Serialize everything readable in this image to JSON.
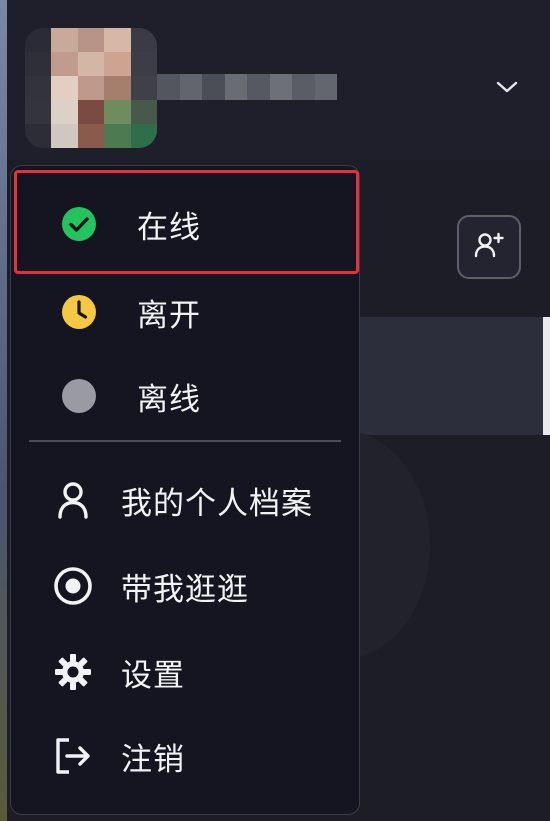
{
  "header": {
    "avatar_colors": [
      [
        "#2a2b36",
        "#c9a99a",
        "#b89488",
        "#d7b8a7",
        "#3a3b44"
      ],
      [
        "#2e2f38",
        "#c19c8e",
        "#d4b6a6",
        "#cda492",
        "#3c3d46"
      ],
      [
        "#33333d",
        "#e2cfc2",
        "#bf9a8c",
        "#a67e6c",
        "#3f4048"
      ],
      [
        "#34343e",
        "#ddd0c6",
        "#7a4b40",
        "#6e8c5e",
        "#47594a"
      ],
      [
        "#2c2d37",
        "#cfc7c0",
        "#8a5a4c",
        "#4e7a52",
        "#2f6e4a"
      ]
    ],
    "name_blur_colors": [
      "#54565f",
      "#63656e",
      "#4c4e57",
      "#6a6c74",
      "#575962",
      "#6e7078",
      "#5b5d66",
      "#64666f"
    ],
    "chevron_icon": "chevron-down-icon"
  },
  "menu": {
    "status_items": [
      {
        "label": "在线",
        "icon": "online-check-icon",
        "color": "#23c35d"
      },
      {
        "label": "离开",
        "icon": "away-clock-icon",
        "color": "#f5c842"
      },
      {
        "label": "离线",
        "icon": "offline-dot-icon",
        "color": "#9a9aa2"
      }
    ],
    "action_items": [
      {
        "label": "我的个人档案",
        "icon": "profile-icon"
      },
      {
        "label": "带我逛逛",
        "icon": "tour-target-icon"
      },
      {
        "label": "设置",
        "icon": "gear-icon"
      },
      {
        "label": "注销",
        "icon": "logout-icon"
      }
    ],
    "selected_status": "在线",
    "highlight_color": "#e8303a"
  },
  "toolbar": {
    "add_friend_icon": "add-friend-icon"
  }
}
